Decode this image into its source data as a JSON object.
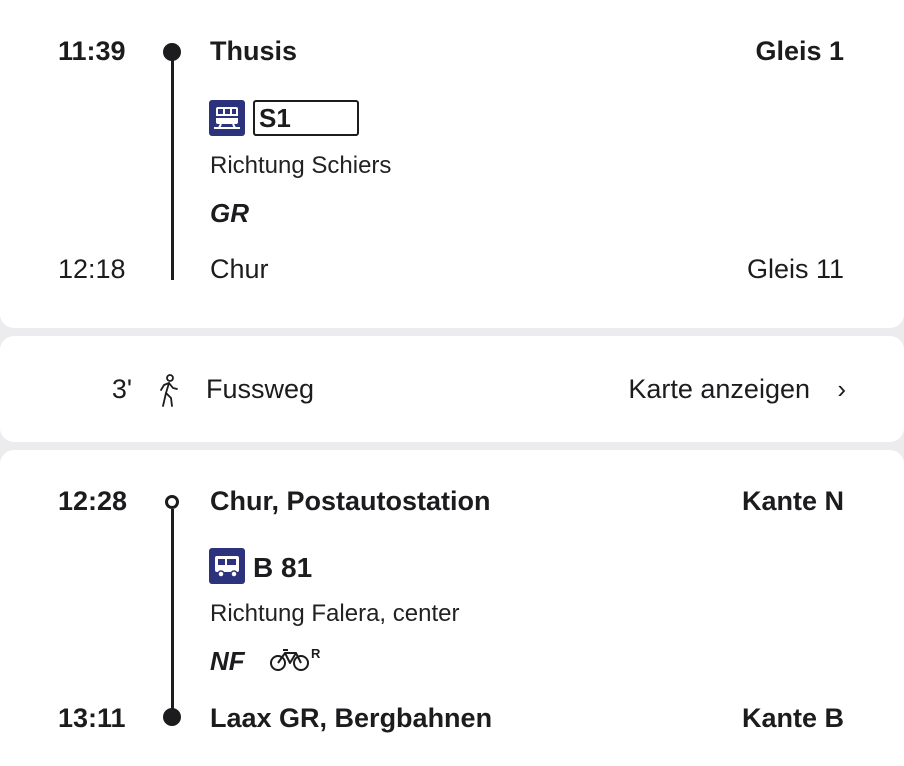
{
  "leg1": {
    "departure_time": "11:39",
    "departure_stop": "Thusis",
    "departure_platform": "Gleis 1",
    "mode_icon": "train-icon",
    "line": "S1",
    "direction": "Richtung Schiers",
    "operator": "GR",
    "arrival_time": "12:18",
    "arrival_stop": "Chur",
    "arrival_platform": "Gleis 11"
  },
  "walk": {
    "duration": "3'",
    "icon": "pedestrian-icon",
    "label": "Fussweg",
    "map_link": "Karte anzeigen",
    "chevron": "›"
  },
  "leg2": {
    "departure_time": "12:28",
    "departure_stop": "Chur, Postautostation",
    "departure_platform": "Kante N",
    "mode_icon": "bus-icon",
    "line": "B 81",
    "direction": "Richtung Falera, center",
    "operator": "NF",
    "attribute_icon": "bicycle-reservation-icon",
    "attribute_mark": "R",
    "arrival_time": "13:11",
    "arrival_stop": "Laax GR, Bergbahnen",
    "arrival_platform": "Kante B"
  },
  "colors": {
    "page_background": "#ececee",
    "card_background": "#ffffff",
    "text": "#1c1c1e",
    "transport_icon_background": "#2d327d"
  }
}
